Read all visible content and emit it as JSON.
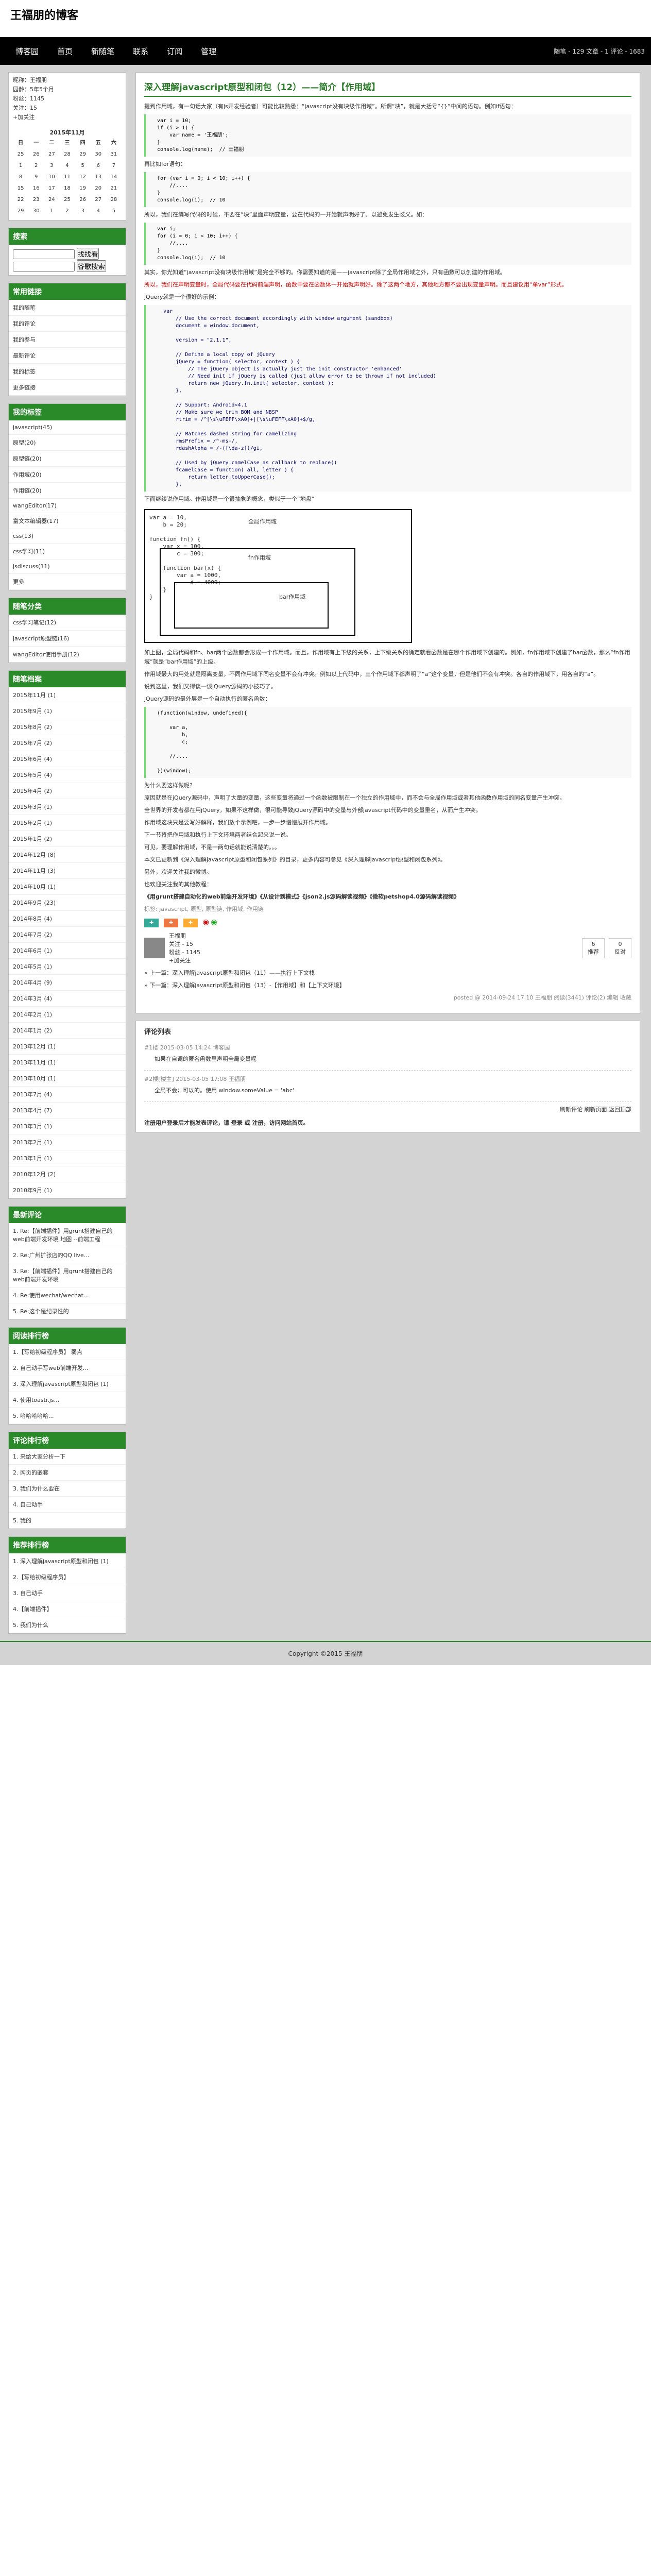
{
  "blog": {
    "title": "王福朋的博客",
    "stats": "随笔 - 129 文章 - 1 评论 - 1683"
  },
  "nav": [
    "博客园",
    "首页",
    "新随笔",
    "联系",
    "订阅",
    "管理"
  ],
  "profile": [
    "昵称：王福朋",
    "园龄：5年5个月",
    "粉丝：1145",
    "关注：15",
    "+加关注"
  ],
  "calendar": {
    "title": "2015年11月",
    "head": [
      "日",
      "一",
      "二",
      "三",
      "四",
      "五",
      "六"
    ],
    "rows": [
      [
        "25",
        "26",
        "27",
        "28",
        "29",
        "30",
        "31"
      ],
      [
        "1",
        "2",
        "3",
        "4",
        "5",
        "6",
        "7"
      ],
      [
        "8",
        "9",
        "10",
        "11",
        "12",
        "13",
        "14"
      ],
      [
        "15",
        "16",
        "17",
        "18",
        "19",
        "20",
        "21"
      ],
      [
        "22",
        "23",
        "24",
        "25",
        "26",
        "27",
        "28"
      ],
      [
        "29",
        "30",
        "1",
        "2",
        "3",
        "4",
        "5"
      ]
    ]
  },
  "search": {
    "title": "搜索",
    "btn1": "找找看",
    "btn2": "谷歌搜索"
  },
  "links": {
    "title": "常用链接",
    "items": [
      "我的随笔",
      "我的评论",
      "我的参与",
      "最新评论",
      "我的标签",
      "更多链接"
    ]
  },
  "tags": {
    "title": "我的标签",
    "items": [
      "javascript(45)",
      "原型(20)",
      "原型链(20)",
      "作用域(20)",
      "作用链(20)",
      "wangEditor(17)",
      "富文本编辑器(17)",
      "css(13)",
      "css学习(11)",
      "jsdiscuss(11)",
      "更多"
    ]
  },
  "cats": {
    "title": "随笔分类",
    "items": [
      "css学习笔记(12)",
      "javascript原型链(16)",
      "wangEditor使用手册(12)"
    ]
  },
  "archive": {
    "title": "随笔档案",
    "items": [
      "2015年11月 (1)",
      "2015年9月 (1)",
      "2015年8月 (2)",
      "2015年7月 (2)",
      "2015年6月 (4)",
      "2015年5月 (4)",
      "2015年4月 (2)",
      "2015年3月 (1)",
      "2015年2月 (1)",
      "2015年1月 (2)",
      "2014年12月 (8)",
      "2014年11月 (3)",
      "2014年10月 (1)",
      "2014年9月 (23)",
      "2014年8月 (4)",
      "2014年7月 (2)",
      "2014年6月 (1)",
      "2014年5月 (1)",
      "2014年4月 (9)",
      "2014年3月 (4)",
      "2014年2月 (1)",
      "2014年1月 (2)",
      "2013年12月 (1)",
      "2013年11月 (1)",
      "2013年10月 (1)",
      "2013年7月 (4)",
      "2013年4月 (7)",
      "2013年3月 (1)",
      "2013年2月 (1)",
      "2013年1月 (1)",
      "2010年12月 (2)",
      "2010年9月 (1)"
    ]
  },
  "recent": {
    "title": "最新评论",
    "items": [
      "1. Re:【前端插件】用grunt搭建自己的web前端开发环境 地图 --前端工程",
      "2. Re:广州扩张店的QQ live...",
      "3. Re:【前端插件】用grunt搭建自己的web前端开发环境",
      "4. Re:使用wechat/wechat...",
      "5. Re:这个是纪录性的"
    ]
  },
  "read": {
    "title": "阅读排行榜",
    "items": [
      "1.【写给初级程序员】 弱点",
      "2. 自己动手写web前端开发...",
      "3. 深入理解javascript原型和闭包 (1)",
      "4. 使用toastr.js...",
      "5. 哈哈哈哈哈..."
    ]
  },
  "commentRank": {
    "title": "评论排行榜",
    "items": [
      "1. 来给大家分析一下",
      "2. 网页的嵌套",
      "3. 我们为什么要在",
      "4. 自己动手",
      "5. 我的"
    ]
  },
  "recommend": {
    "title": "推荐排行榜",
    "items": [
      "1. 深入理解javascript原型和闭包 (1)",
      "2.【写给初级程序员】",
      "3. 自己动手",
      "4.【前端插件】",
      "5. 我们为什么"
    ]
  },
  "post": {
    "title": "深入理解javascript原型和闭包（12）——简介【作用域】",
    "p1": "提到作用域，有一句话大家（有js开发经验者）可能比较熟悉：“javascript没有块级作用域”。所谓“块”，就是大括号“{}”中间的语句。例如if语句：",
    "code1": "  var i = 10;\n  if (i > 1) {\n      var name = '王福朋';\n  }\n  console.log(name);  // 王福朋",
    "p2": "再比如for语句：",
    "code2": "  for (var i = 0; i < 10; i++) {\n      //....\n  }\n  console.log(i);  // 10",
    "p3": "所以，我们在编写代码的时候，不要在“块”里面声明变量，要在代码的一开始就声明好了。以避免发生歧义。如：",
    "code3": "  var i;\n  for (i = 0; i < 10; i++) {\n      //....\n  }\n  console.log(i);  // 10",
    "p4": "其实，你光知道“javascript没有块级作用域”是完全不够的。你需要知道的是——javascript除了全局作用域之外，只有函数可以创建的作用域。",
    "p5": "所以，我们在声明变量时，全局代码要在代码前端声明，函数中要在函数体一开始就声明好。除了这两个地方，其他地方都不要出现变量声明。而且建议用“单var”形式。",
    "p6": "jQuery就是一个很好的示例：",
    "code4": "    var\n        // Use the correct document accordingly with window argument (sandbox)\n        document = window.document,\n\n        version = \"2.1.1\",\n\n        // Define a local copy of jQuery\n        jQuery = function( selector, context ) {\n            // The jQuery object is actually just the init constructor 'enhanced'\n            // Need init if jQuery is called (just allow error to be thrown if not included)\n            return new jQuery.fn.init( selector, context );\n        },\n\n        // Support: Android<4.1\n        // Make sure we trim BOM and NBSP\n        rtrim = /^[\\s\\uFEFF\\xA0]+|[\\s\\uFEFF\\xA0]+$/g,\n\n        // Matches dashed string for camelizing\n        rmsPrefix = /^-ms-/,\n        rdashAlpha = /-([\\da-z])/gi,\n\n        // Used by jQuery.camelCase as callback to replace()\n        fcamelCase = function( all, letter ) {\n            return letter.toUpperCase();\n        },",
    "p7": "下面继续说作用域。作用域是一个很抽象的概念，类似于一个“地盘”",
    "d1": "全局作用域",
    "d2": "fn作用域",
    "d3": "bar作用域",
    "code_d": "var a = 10,\n    b = 20;\n\nfunction fn() {\n    var x = 100,\n        c = 300;\n\n    function bar(x) {\n        var a = 1000,\n            d = 4000;\n    }\n}",
    "p8": "如上图，全局代码和fn、bar两个函数都会形成一个作用域。而且，作用域有上下级的关系，上下级关系的确定就看函数是在哪个作用域下创建的。例如，fn作用域下创建了bar函数，那么“fn作用域”就是“bar作用域”的上级。",
    "p9": "作用域最大的用处就是隔离变量，不同作用域下同名变量不会有冲突。例如以上代码中，三个作用域下都声明了“a”这个变量，但是他们不会有冲突。各自的作用域下，用各自的“a”。",
    "p10": "说到这里，我们又得谈一谈jQuery源码的小技巧了。",
    "p11": "jQuery源码的最外层是一个自动执行的匿名函数：",
    "code5": "  (function(window, undefined){\n\n      var a,\n          b,\n          c;\n\n      //....\n\n  })(window);",
    "p12": "为什么要这样做呢？",
    "p13": "原因就是在jQuery源码中，声明了大量的变量，这些变量将通过一个函数被限制在一个独立的作用域中，而不会与全局作用域或者其他函数作用域的同名变量产生冲突。",
    "p14": "全世界的开发者都在用jQuery，如果不这样做，很可能导致jQuery源码中的变量与外部javascript代码中的变量重名，从而产生冲突。",
    "p15": "作用域这块只是要写好解释，我们放个示例吧，一步一步慢慢展开作用域。",
    "p16": "下一节将把作用域和执行上下文环境两者结合起来说一说。",
    "p17": "可见，要理解作用域，不是一两句话就能说清楚的。。。",
    "p18": "本文已更新到《深入理解javascript原型和闭包系列》的目录，更多内容可参见《深入理解javascript原型和闭包系列》。",
    "p19": "另外，欢迎关注我的微博。",
    "p20": "也欢迎关注我的其他教程：",
    "p21": "《用grunt搭建自动化的web前端开发环境》《从设计到模式》《json2.js源码解读视频》《微软petshop4.0源码解读视频》",
    "tags": "标签: javascript, 原型, 原型链, 作用域, 作用链",
    "footer": "posted @ 2014-09-24 17:10 王福朋 阅读(3441) 评论(2) 编辑 收藏",
    "prev": "« 上一篇：深入理解javascript原型和闭包（11）——执行上下文栈",
    "next": "» 下一篇：深入理解javascript原型和闭包（13）-【作用域】和【上下文环境】"
  },
  "author": {
    "name": "王福朋",
    "follow": "关注 - 15",
    "fans": "粉丝 - 1145",
    "plus": "+加关注"
  },
  "vote": {
    "up": "6",
    "down": "0",
    "up_label": "推荐",
    "down_label": "反对"
  },
  "comments": {
    "title": "评论列表",
    "items": [
      {
        "head": "#1楼 2015-03-05 14:24 博客园",
        "text": "如果在自调的匿名函数里声明全局变量呢"
      },
      {
        "head": "#2楼[楼主] 2015-03-05 17:08 王福朋",
        "text": "全局不会；可以的。使用 window.someValue = 'abc'"
      }
    ],
    "refresh": "刷新评论 刷新页面 返回顶部"
  },
  "notice": "注册用户登录后才能发表评论，请 登录 或 注册，访问网站首页。",
  "footer": "Copyright ©2015 王福朋"
}
